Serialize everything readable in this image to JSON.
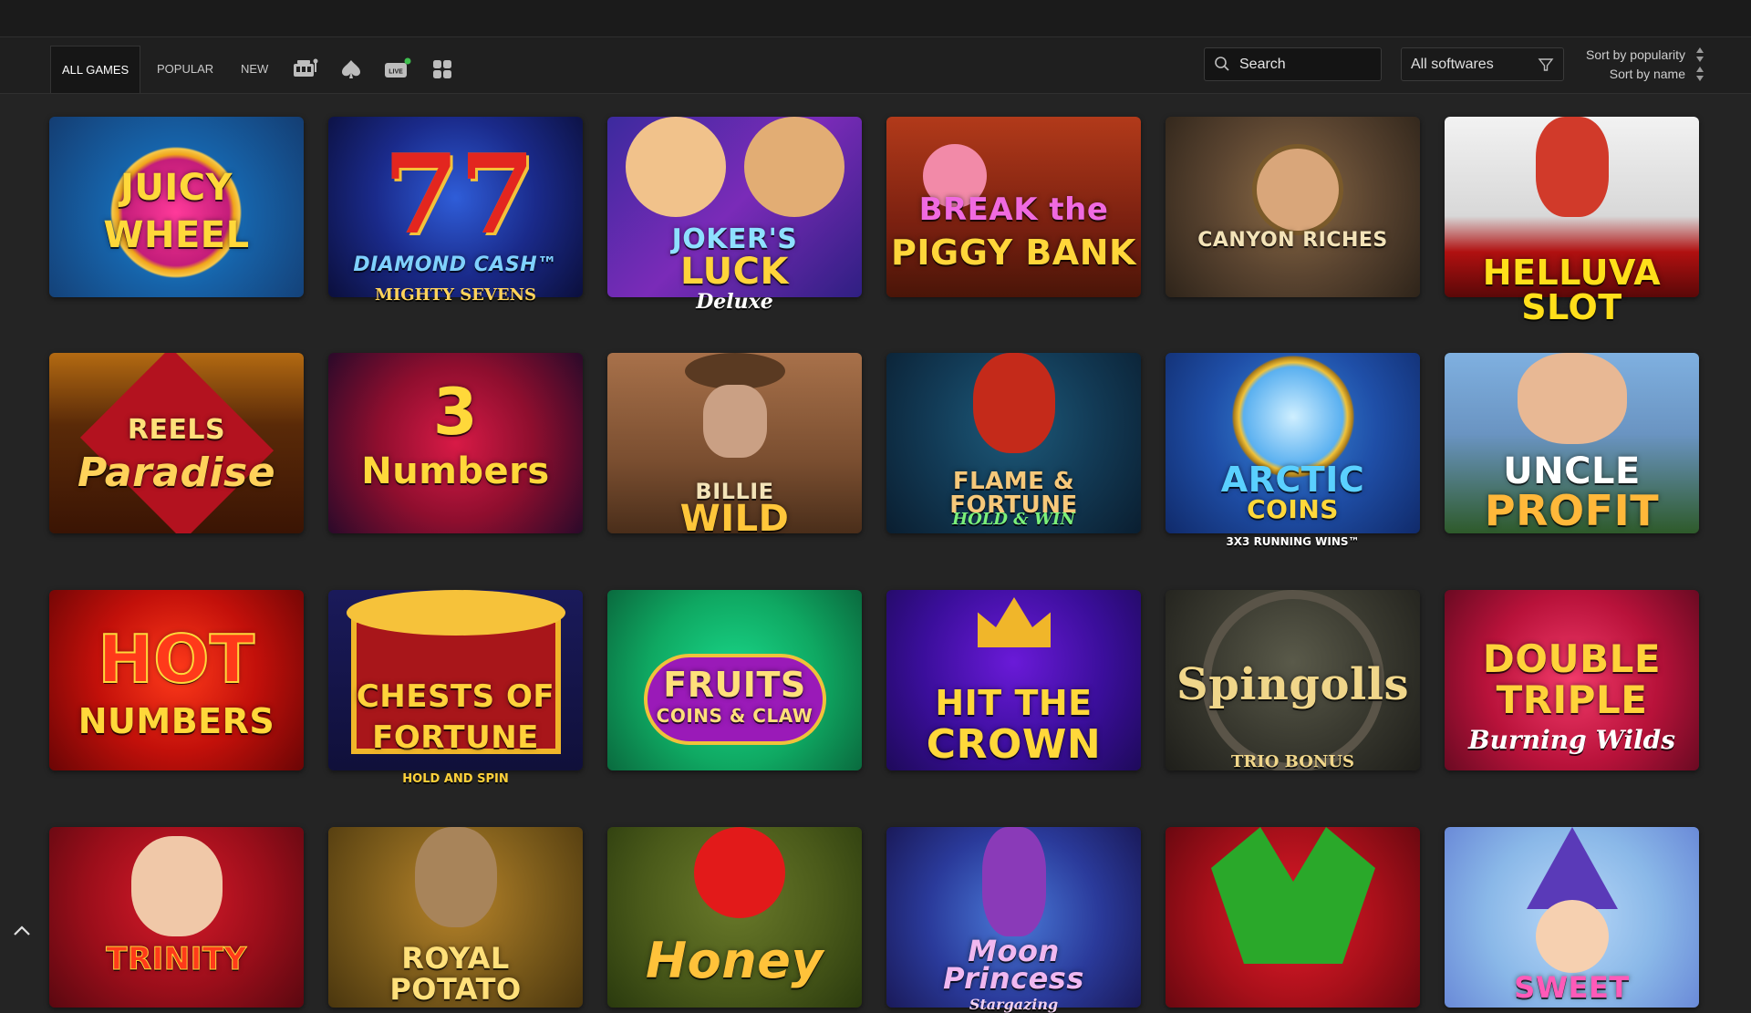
{
  "tabs": {
    "all_games": "ALL GAMES",
    "popular": "POPULAR",
    "new": "NEW"
  },
  "tab_icons": [
    "slot-machine-icon",
    "spade-icon",
    "live-icon",
    "grid-icon"
  ],
  "live_label": "LIVE",
  "search": {
    "placeholder": "Search"
  },
  "software_filter": {
    "selected": "All softwares"
  },
  "sort": {
    "popularity": "Sort by popularity",
    "name": "Sort by name"
  },
  "colors": {
    "background": "#242424",
    "bar": "#1f1f1f",
    "live_dot": "#3fbf4f"
  },
  "games": [
    {
      "title": "JUICY",
      "title2": "WHEEL",
      "subtitle": ""
    },
    {
      "title": "DIAMOND CASH™",
      "title2": "",
      "subtitle": "MIGHTY SEVENS"
    },
    {
      "title": "JOKER'S",
      "title2": "LUCK",
      "subtitle": "Deluxe"
    },
    {
      "title": "BREAK the",
      "title2": "PIGGY BANK",
      "subtitle": ""
    },
    {
      "title": "CANYON RICHES",
      "title2": "",
      "subtitle": ""
    },
    {
      "title": "HELLUVA SLOT",
      "title2": "",
      "subtitle": ""
    },
    {
      "title": "REELS",
      "title2": "Paradise",
      "subtitle": ""
    },
    {
      "title": "3",
      "title2": "Numbers",
      "subtitle": ""
    },
    {
      "title": "BILLIE",
      "title2": "WILD",
      "subtitle": ""
    },
    {
      "title": "FLAME & FORTUNE",
      "title2": "",
      "subtitle": "HOLD & WIN"
    },
    {
      "title": "ARCTIC",
      "title2": "COINS",
      "subtitle": "3X3 RUNNING WINS™"
    },
    {
      "title": "UNCLE",
      "title2": "PROFIT",
      "subtitle": ""
    },
    {
      "title": "HOT",
      "title2": "NUMBERS",
      "subtitle": ""
    },
    {
      "title": "CHESTS OF",
      "title2": "FORTUNE",
      "subtitle": "HOLD AND SPIN"
    },
    {
      "title": "FRUITS",
      "title2": "COINS & CLAW",
      "subtitle": ""
    },
    {
      "title": "HIT THE",
      "title2": "CROWN",
      "subtitle": ""
    },
    {
      "title": "Spingolls",
      "title2": "",
      "subtitle": "TRIO BONUS"
    },
    {
      "title": "DOUBLE",
      "title2": "TRIPLE",
      "subtitle": "Burning Wilds"
    },
    {
      "title": "TRINITY",
      "title2": "",
      "subtitle": ""
    },
    {
      "title": "ROYAL",
      "title2": "POTATO",
      "subtitle": ""
    },
    {
      "title": "Honey",
      "title2": "",
      "subtitle": ""
    },
    {
      "title": "Moon",
      "title2": "Princess",
      "subtitle": "Stargazing"
    },
    {
      "title": "",
      "title2": "",
      "subtitle": ""
    },
    {
      "title": "SWEET",
      "title2": "",
      "subtitle": ""
    }
  ]
}
